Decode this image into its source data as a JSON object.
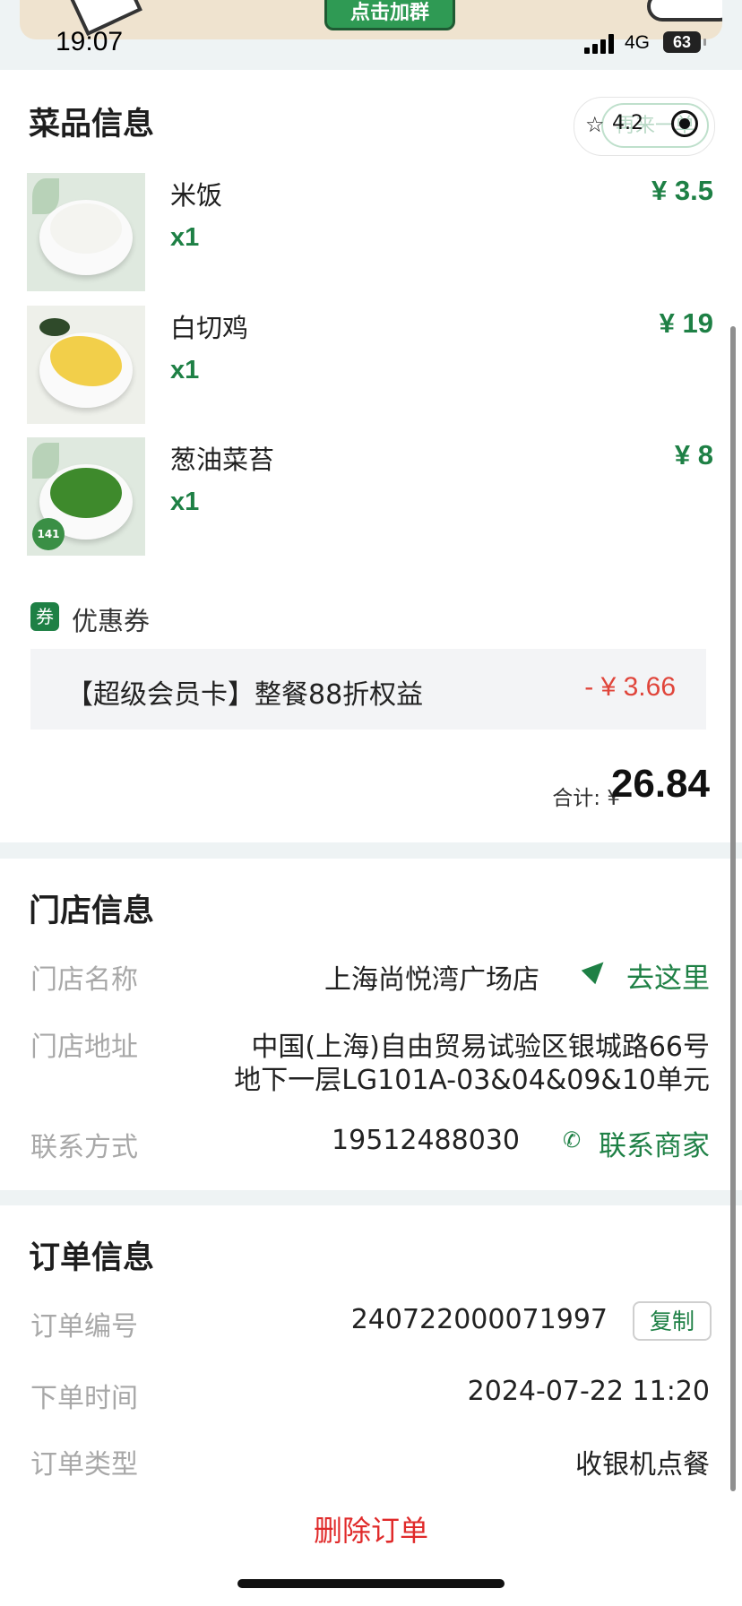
{
  "banner": {
    "button_label": "点击加群"
  },
  "status_bar": {
    "time": "19:07",
    "network": "4G",
    "battery": "63"
  },
  "dishes_section": {
    "title": "菜品信息",
    "rating": "4.2",
    "ghost_button": "再来一单",
    "items": [
      {
        "name": "米饭",
        "qty": "x1",
        "price": "¥ 3.5"
      },
      {
        "name": "白切鸡",
        "qty": "x1",
        "price": "¥ 19"
      },
      {
        "name": "葱油菜苔",
        "qty": "x1",
        "price": "¥ 8"
      }
    ],
    "coupon_icon_text": "券",
    "coupon_title": "优惠券",
    "coupon_text": "【超级会员卡】整餐88折权益",
    "coupon_amount": "- ¥ 3.66",
    "total_label": "合计: ¥",
    "total_value": "26.84"
  },
  "store_section": {
    "title": "门店信息",
    "name_label": "门店名称",
    "name_value": "上海尚悦湾广场店",
    "go_label": "去这里",
    "address_label": "门店地址",
    "address_line1": "中国(上海)自由贸易试验区银城路66号",
    "address_line2": "地下一层LG101A-03&04&09&10单元",
    "contact_label": "联系方式",
    "contact_value": "19512488030",
    "contact_link": "联系商家"
  },
  "order_section": {
    "title": "订单信息",
    "number_label": "订单编号",
    "number_value": "240722000071997",
    "copy_label": "复制",
    "time_label": "下单时间",
    "time_value": "2024-07-22 11:20",
    "type_label": "订单类型",
    "type_value": "收银机点餐",
    "delete_label": "删除订单"
  },
  "colors": {
    "accent": "#1e8045",
    "danger": "#e02a2a",
    "discount": "#e0453b"
  },
  "icons": [
    "star-icon",
    "target-icon",
    "coupon-icon",
    "navigation-arrow-icon",
    "phone-icon"
  ]
}
